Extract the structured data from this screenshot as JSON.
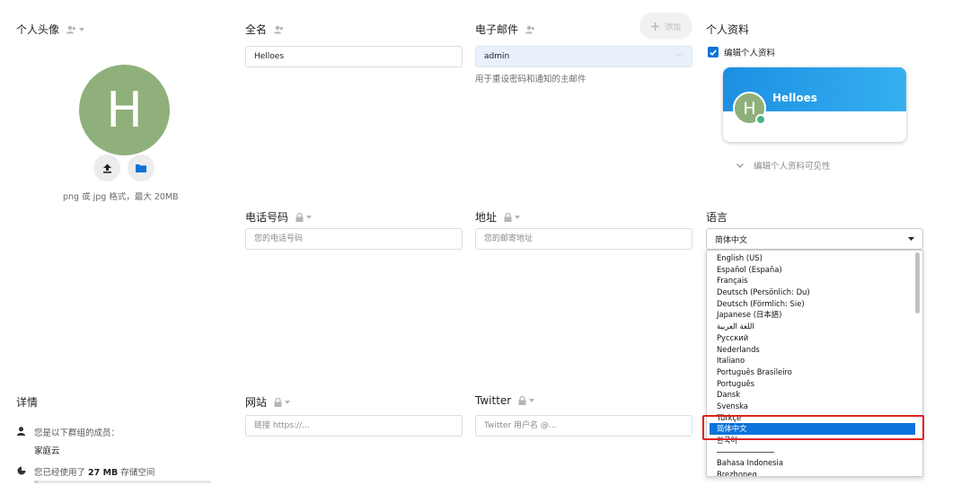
{
  "avatar": {
    "section_label": "个人头像",
    "initial": "H",
    "upload_icon": "upload-icon",
    "folder_icon": "folder-icon",
    "hint": "png 或 jpg 格式，最大 20MB"
  },
  "fullname": {
    "label": "全名",
    "value": "Helloes"
  },
  "email": {
    "label": "电子邮件",
    "add_label": "添加",
    "value": "admin",
    "more": "···",
    "hint": "用于重设密码和通知的主邮件"
  },
  "profile": {
    "section_label": "个人资料",
    "checkbox_label": "编辑个人资料",
    "card_name": "Helloes",
    "card_initial": "H",
    "visibility_label": "编辑个人资料可见性"
  },
  "phone": {
    "label": "电话号码",
    "placeholder": "您的电话号码"
  },
  "address": {
    "label": "地址",
    "placeholder": "您的邮寄地址"
  },
  "language": {
    "label": "语言",
    "selected": "简体中文",
    "options_before_sep": [
      "English (US)",
      "Español (España)",
      "Français",
      "Deutsch (Persönlich: Du)",
      "Deutsch (Förmlich: Sie)",
      "Japanese (日本語)",
      "اللغة العربية",
      "Русский",
      "Nederlands",
      "Italiano",
      "Português Brasileiro",
      "Português",
      "Dansk",
      "Svenska",
      "Türkçe",
      "简体中文",
      "한국어"
    ],
    "options_after_sep": [
      "Bahasa Indonesia",
      "Brezhoneg"
    ]
  },
  "details": {
    "section_label": "详情",
    "group_text": "您是以下群组的成员：",
    "group_name": "家庭云",
    "usage_prefix": "您已经使用了",
    "usage_amount": "27 MB",
    "usage_suffix": "存储空间",
    "usage_fraction": 0.02
  },
  "website": {
    "label": "网站",
    "placeholder": "链接 https://..."
  },
  "twitter": {
    "label": "Twitter",
    "placeholder": "Twitter 用户名 @..."
  },
  "colors": {
    "accent": "#0b73d9",
    "avatar": "#8fb07a",
    "highlight": "#e02323",
    "status": "#49b382"
  }
}
